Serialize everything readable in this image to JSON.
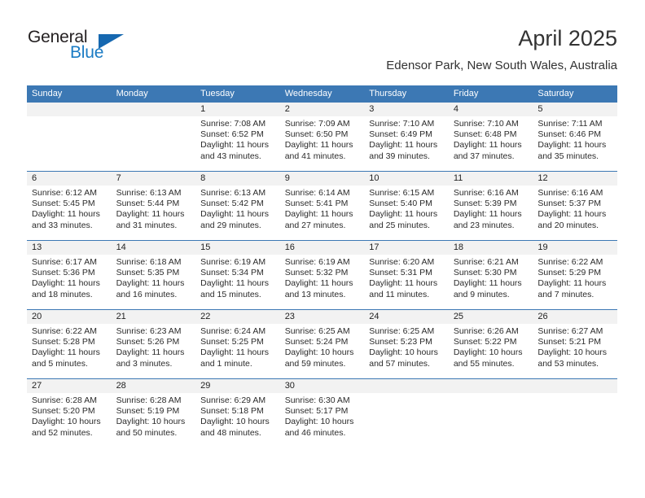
{
  "brand": {
    "name_part1": "General",
    "name_part2": "Blue",
    "triangle_color": "#1668b0",
    "blue_color": "#1a7bc4"
  },
  "header": {
    "title": "April 2025",
    "subtitle": "Edensor Park, New South Wales, Australia"
  },
  "theme": {
    "header_blue": "#3c78b4",
    "daynum_band": "#f2f2f2",
    "text": "#2b2b2b"
  },
  "weekday_headers": [
    "Sunday",
    "Monday",
    "Tuesday",
    "Wednesday",
    "Thursday",
    "Friday",
    "Saturday"
  ],
  "labels": {
    "sunrise_prefix": "Sunrise:",
    "sunset_prefix": "Sunset:",
    "daylight_prefix": "Daylight:"
  },
  "weeks": [
    [
      {
        "day": "",
        "sunrise": "",
        "sunset": "",
        "daylight1": "",
        "daylight2": "",
        "empty": true
      },
      {
        "day": "",
        "sunrise": "",
        "sunset": "",
        "daylight1": "",
        "daylight2": "",
        "empty": true
      },
      {
        "day": "1",
        "sunrise": "Sunrise: 7:08 AM",
        "sunset": "Sunset: 6:52 PM",
        "daylight1": "Daylight: 11 hours",
        "daylight2": "and 43 minutes."
      },
      {
        "day": "2",
        "sunrise": "Sunrise: 7:09 AM",
        "sunset": "Sunset: 6:50 PM",
        "daylight1": "Daylight: 11 hours",
        "daylight2": "and 41 minutes."
      },
      {
        "day": "3",
        "sunrise": "Sunrise: 7:10 AM",
        "sunset": "Sunset: 6:49 PM",
        "daylight1": "Daylight: 11 hours",
        "daylight2": "and 39 minutes."
      },
      {
        "day": "4",
        "sunrise": "Sunrise: 7:10 AM",
        "sunset": "Sunset: 6:48 PM",
        "daylight1": "Daylight: 11 hours",
        "daylight2": "and 37 minutes."
      },
      {
        "day": "5",
        "sunrise": "Sunrise: 7:11 AM",
        "sunset": "Sunset: 6:46 PM",
        "daylight1": "Daylight: 11 hours",
        "daylight2": "and 35 minutes."
      }
    ],
    [
      {
        "day": "6",
        "sunrise": "Sunrise: 6:12 AM",
        "sunset": "Sunset: 5:45 PM",
        "daylight1": "Daylight: 11 hours",
        "daylight2": "and 33 minutes."
      },
      {
        "day": "7",
        "sunrise": "Sunrise: 6:13 AM",
        "sunset": "Sunset: 5:44 PM",
        "daylight1": "Daylight: 11 hours",
        "daylight2": "and 31 minutes."
      },
      {
        "day": "8",
        "sunrise": "Sunrise: 6:13 AM",
        "sunset": "Sunset: 5:42 PM",
        "daylight1": "Daylight: 11 hours",
        "daylight2": "and 29 minutes."
      },
      {
        "day": "9",
        "sunrise": "Sunrise: 6:14 AM",
        "sunset": "Sunset: 5:41 PM",
        "daylight1": "Daylight: 11 hours",
        "daylight2": "and 27 minutes."
      },
      {
        "day": "10",
        "sunrise": "Sunrise: 6:15 AM",
        "sunset": "Sunset: 5:40 PM",
        "daylight1": "Daylight: 11 hours",
        "daylight2": "and 25 minutes."
      },
      {
        "day": "11",
        "sunrise": "Sunrise: 6:16 AM",
        "sunset": "Sunset: 5:39 PM",
        "daylight1": "Daylight: 11 hours",
        "daylight2": "and 23 minutes."
      },
      {
        "day": "12",
        "sunrise": "Sunrise: 6:16 AM",
        "sunset": "Sunset: 5:37 PM",
        "daylight1": "Daylight: 11 hours",
        "daylight2": "and 20 minutes."
      }
    ],
    [
      {
        "day": "13",
        "sunrise": "Sunrise: 6:17 AM",
        "sunset": "Sunset: 5:36 PM",
        "daylight1": "Daylight: 11 hours",
        "daylight2": "and 18 minutes."
      },
      {
        "day": "14",
        "sunrise": "Sunrise: 6:18 AM",
        "sunset": "Sunset: 5:35 PM",
        "daylight1": "Daylight: 11 hours",
        "daylight2": "and 16 minutes."
      },
      {
        "day": "15",
        "sunrise": "Sunrise: 6:19 AM",
        "sunset": "Sunset: 5:34 PM",
        "daylight1": "Daylight: 11 hours",
        "daylight2": "and 15 minutes."
      },
      {
        "day": "16",
        "sunrise": "Sunrise: 6:19 AM",
        "sunset": "Sunset: 5:32 PM",
        "daylight1": "Daylight: 11 hours",
        "daylight2": "and 13 minutes."
      },
      {
        "day": "17",
        "sunrise": "Sunrise: 6:20 AM",
        "sunset": "Sunset: 5:31 PM",
        "daylight1": "Daylight: 11 hours",
        "daylight2": "and 11 minutes."
      },
      {
        "day": "18",
        "sunrise": "Sunrise: 6:21 AM",
        "sunset": "Sunset: 5:30 PM",
        "daylight1": "Daylight: 11 hours",
        "daylight2": "and 9 minutes."
      },
      {
        "day": "19",
        "sunrise": "Sunrise: 6:22 AM",
        "sunset": "Sunset: 5:29 PM",
        "daylight1": "Daylight: 11 hours",
        "daylight2": "and 7 minutes."
      }
    ],
    [
      {
        "day": "20",
        "sunrise": "Sunrise: 6:22 AM",
        "sunset": "Sunset: 5:28 PM",
        "daylight1": "Daylight: 11 hours",
        "daylight2": "and 5 minutes."
      },
      {
        "day": "21",
        "sunrise": "Sunrise: 6:23 AM",
        "sunset": "Sunset: 5:26 PM",
        "daylight1": "Daylight: 11 hours",
        "daylight2": "and 3 minutes."
      },
      {
        "day": "22",
        "sunrise": "Sunrise: 6:24 AM",
        "sunset": "Sunset: 5:25 PM",
        "daylight1": "Daylight: 11 hours",
        "daylight2": "and 1 minute."
      },
      {
        "day": "23",
        "sunrise": "Sunrise: 6:25 AM",
        "sunset": "Sunset: 5:24 PM",
        "daylight1": "Daylight: 10 hours",
        "daylight2": "and 59 minutes."
      },
      {
        "day": "24",
        "sunrise": "Sunrise: 6:25 AM",
        "sunset": "Sunset: 5:23 PM",
        "daylight1": "Daylight: 10 hours",
        "daylight2": "and 57 minutes."
      },
      {
        "day": "25",
        "sunrise": "Sunrise: 6:26 AM",
        "sunset": "Sunset: 5:22 PM",
        "daylight1": "Daylight: 10 hours",
        "daylight2": "and 55 minutes."
      },
      {
        "day": "26",
        "sunrise": "Sunrise: 6:27 AM",
        "sunset": "Sunset: 5:21 PM",
        "daylight1": "Daylight: 10 hours",
        "daylight2": "and 53 minutes."
      }
    ],
    [
      {
        "day": "27",
        "sunrise": "Sunrise: 6:28 AM",
        "sunset": "Sunset: 5:20 PM",
        "daylight1": "Daylight: 10 hours",
        "daylight2": "and 52 minutes."
      },
      {
        "day": "28",
        "sunrise": "Sunrise: 6:28 AM",
        "sunset": "Sunset: 5:19 PM",
        "daylight1": "Daylight: 10 hours",
        "daylight2": "and 50 minutes."
      },
      {
        "day": "29",
        "sunrise": "Sunrise: 6:29 AM",
        "sunset": "Sunset: 5:18 PM",
        "daylight1": "Daylight: 10 hours",
        "daylight2": "and 48 minutes."
      },
      {
        "day": "30",
        "sunrise": "Sunrise: 6:30 AM",
        "sunset": "Sunset: 5:17 PM",
        "daylight1": "Daylight: 10 hours",
        "daylight2": "and 46 minutes."
      },
      {
        "day": "",
        "sunrise": "",
        "sunset": "",
        "daylight1": "",
        "daylight2": "",
        "empty": true
      },
      {
        "day": "",
        "sunrise": "",
        "sunset": "",
        "daylight1": "",
        "daylight2": "",
        "empty": true
      },
      {
        "day": "",
        "sunrise": "",
        "sunset": "",
        "daylight1": "",
        "daylight2": "",
        "empty": true
      }
    ]
  ]
}
